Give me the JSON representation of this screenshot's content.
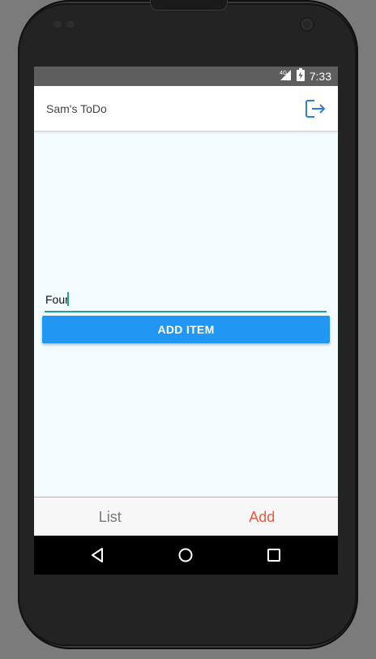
{
  "status_bar": {
    "network": "4G",
    "time": "7:33"
  },
  "header": {
    "title": "Sam's ToDo",
    "logout_icon": "logout-icon"
  },
  "form": {
    "input_value": "Four",
    "add_button_label": "ADD ITEM"
  },
  "tabs": [
    {
      "label": "List",
      "active": false
    },
    {
      "label": "Add",
      "active": true
    }
  ],
  "nav_bar": {
    "icons": [
      "back-icon",
      "home-icon",
      "recents-icon"
    ]
  },
  "colors": {
    "accent_blue": "#2196f3",
    "input_underline": "#1fa291",
    "active_tab": "#f4573d",
    "inactive_tab": "#777777",
    "screen_background": "#f3fbff"
  }
}
